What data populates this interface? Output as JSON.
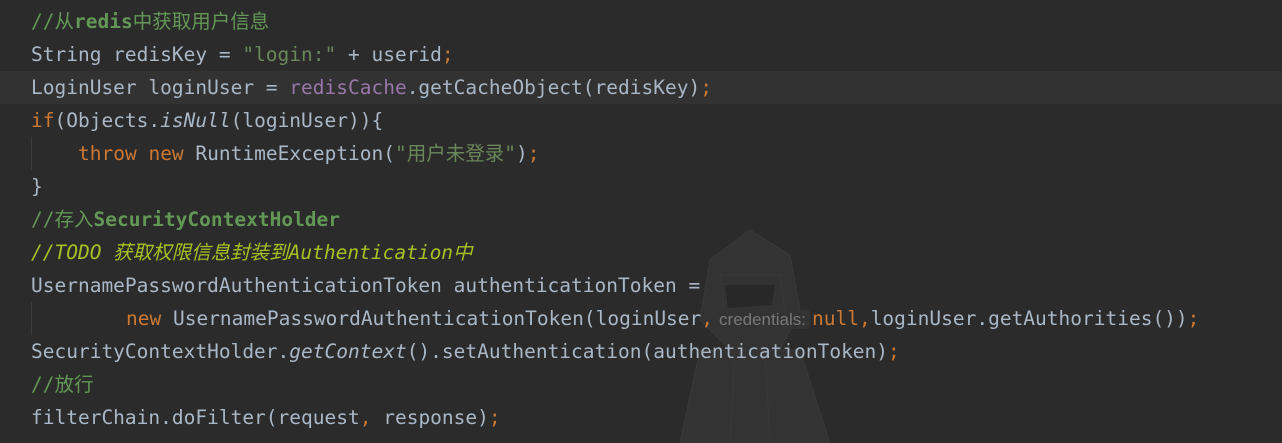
{
  "editor": {
    "lines": [
      {
        "parts": [
          "//从",
          "redis",
          "中获取用户信息"
        ]
      },
      {
        "parts": [
          "String redisKey = ",
          "\"login:\"",
          " + userid",
          ";"
        ]
      },
      {
        "parts": [
          "LoginUser loginUser = ",
          "redisCache",
          ".getCacheObject(redisKey)",
          ";"
        ]
      },
      {
        "parts": [
          "if",
          "(Objects.",
          "isNull",
          "(loginUser)){"
        ]
      },
      {
        "parts": [
          "throw",
          " ",
          "new",
          " RuntimeException(",
          "\"用户未登录\"",
          ")",
          ";"
        ]
      },
      {
        "parts": [
          "}"
        ]
      },
      {
        "parts": [
          "//存入",
          "SecurityContextHolder"
        ]
      },
      {
        "parts": [
          "//",
          "TODO 获取权限信息封装到Authentication中"
        ]
      },
      {
        "parts": [
          "UsernamePasswordAuthenticationToken authenticationToken ="
        ]
      },
      {
        "parts": [
          "new",
          " UsernamePasswordAuthenticationToken(loginUser",
          ",",
          "credentials:",
          "null",
          ",",
          "loginUser.getAuthorities())",
          ";"
        ]
      },
      {
        "parts": [
          "SecurityContextHolder.",
          "getContext",
          "().setAuthentication(authenticationToken)",
          ";"
        ]
      },
      {
        "parts": [
          "//放行"
        ]
      },
      {
        "parts": [
          "filterChain.doFilter(request",
          ",",
          " response)",
          ";"
        ]
      }
    ]
  },
  "colors": {
    "background": "#2b2b2b",
    "current_line": "#323232",
    "comment": "#629755",
    "todo": "#a8c023",
    "keyword": "#cc7832",
    "string": "#6a8759",
    "field": "#9876aa",
    "text": "#a9b7c6"
  },
  "watermark": {
    "icon": "hooded-figure-icon"
  }
}
